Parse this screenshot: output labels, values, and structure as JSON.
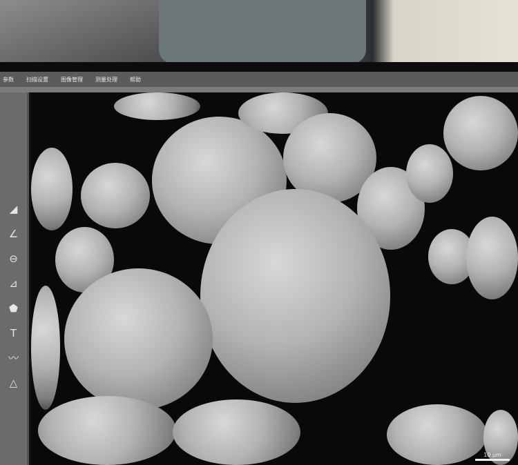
{
  "menu": {
    "items": [
      "参数",
      "扫描设置",
      "图像管理",
      "测量处理",
      "帮助"
    ]
  },
  "toolbar": {
    "tools": [
      {
        "icon": "arrow-icon",
        "glyph": "◢"
      },
      {
        "icon": "angle-icon",
        "glyph": "∠"
      },
      {
        "icon": "circle-line-icon",
        "glyph": "⊖"
      },
      {
        "icon": "angle-measure-icon",
        "glyph": "⊿"
      },
      {
        "icon": "polygon-icon",
        "glyph": "⬟"
      },
      {
        "icon": "text-icon",
        "glyph": "T"
      },
      {
        "icon": "waveform-icon",
        "glyph": "〰"
      },
      {
        "icon": "triangle-icon",
        "glyph": "△"
      }
    ]
  },
  "image": {
    "scale_label": "10 μm"
  }
}
